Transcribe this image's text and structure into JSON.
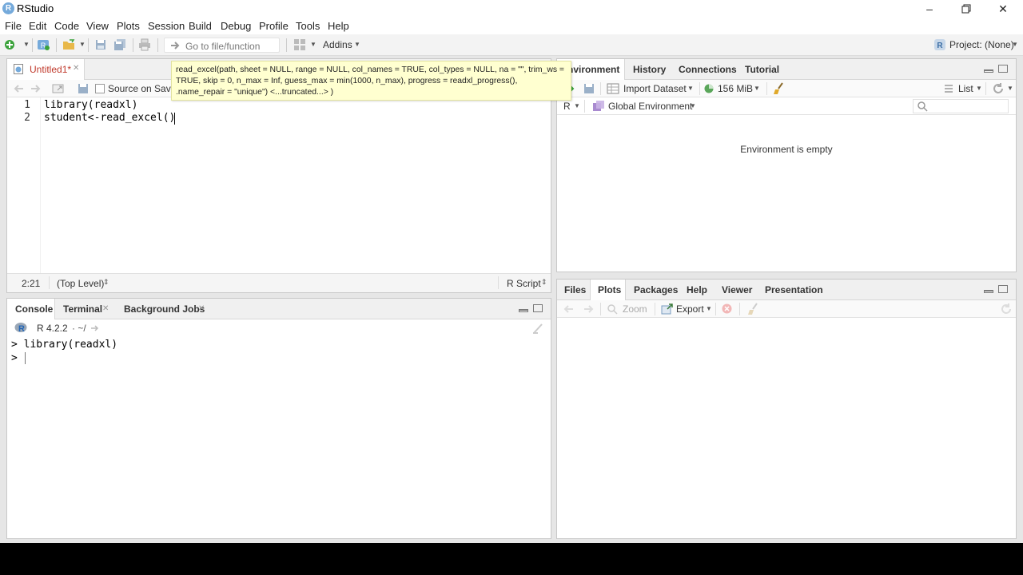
{
  "window": {
    "title": "RStudio",
    "minimize_icon": "minimize-icon",
    "restore_icon": "restore-icon",
    "close_icon": "close-icon"
  },
  "menu": [
    "File",
    "Edit",
    "Code",
    "View",
    "Plots",
    "Session",
    "Build",
    "Debug",
    "Profile",
    "Tools",
    "Help"
  ],
  "toolbar": {
    "goto_placeholder": "Go to file/function",
    "addins_label": "Addins",
    "project_label": "Project: (None)"
  },
  "editor": {
    "tab_label": "Untitled1*",
    "source_on_save": "Source on Save",
    "lines": [
      {
        "num": "1",
        "code": "library(readxl)"
      },
      {
        "num": "2",
        "code": "student<-read_excel()"
      }
    ],
    "cursor_pos": "2:21",
    "scope": "(Top Level)",
    "file_type": "R Script"
  },
  "tooltip": {
    "text": "read_excel(path, sheet = NULL, range = NULL, col_names = TRUE, col_types = NULL, na = \"\", trim_ws = TRUE, skip = 0, n_max = Inf, guess_max = min(1000, n_max), progress = readxl_progress(), .name_repair = \"unique\")  <...truncated...> )"
  },
  "console": {
    "tabs": [
      "Console",
      "Terminal",
      "Background Jobs"
    ],
    "r_version": "R 4.2.2",
    "wd": "· ~/",
    "lines": [
      "> library(readxl)",
      "> "
    ]
  },
  "environment": {
    "tabs": [
      "Environment",
      "History",
      "Connections",
      "Tutorial"
    ],
    "import_label": "Import Dataset",
    "memory_label": "156 MiB",
    "list_label": "List",
    "r_label": "R",
    "scope_label": "Global Environment",
    "empty_message": "Environment is empty"
  },
  "files": {
    "tabs": [
      "Files",
      "Plots",
      "Packages",
      "Help",
      "Viewer",
      "Presentation"
    ],
    "zoom_label": "Zoom",
    "export_label": "Export"
  },
  "colors": {
    "r_blue": "#75aadb",
    "tooltip_bg": "#ffffd0",
    "pane_border": "#c8c8c8"
  }
}
